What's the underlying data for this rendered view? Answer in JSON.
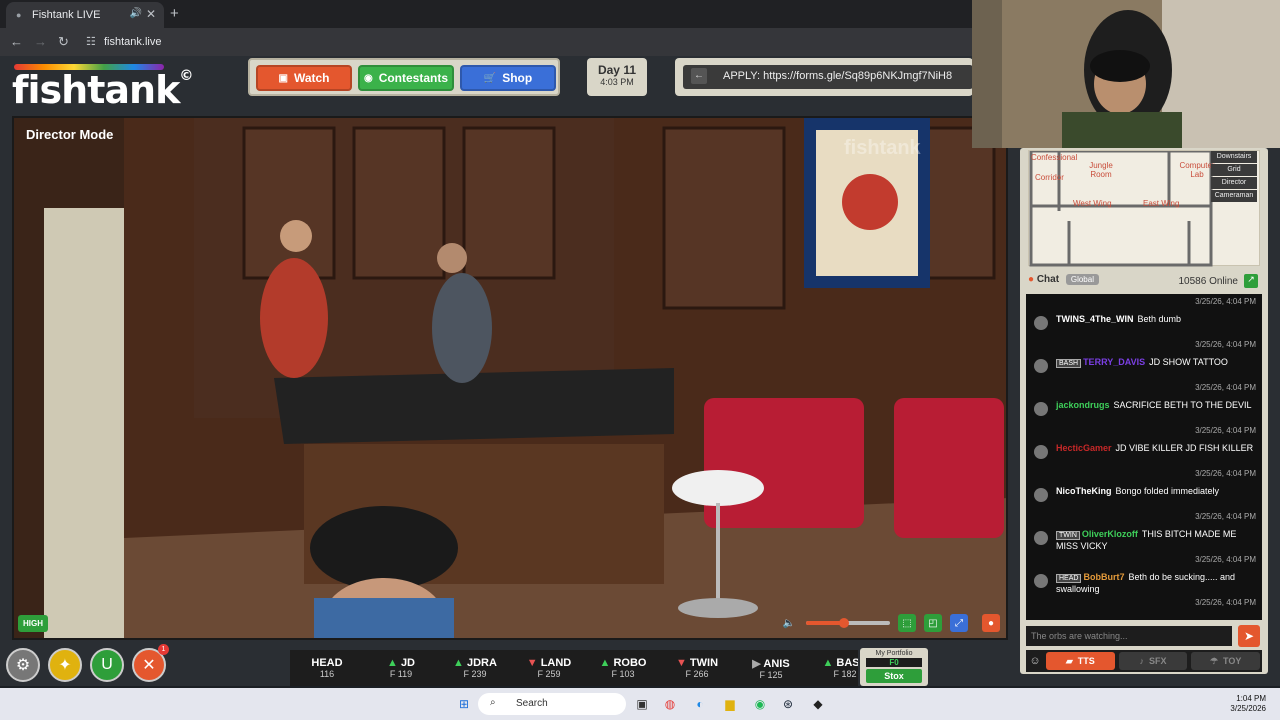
{
  "browser": {
    "tab_title": "Fishtank LIVE",
    "new_tab": "+",
    "url": "fishtank.live"
  },
  "header": {
    "logo": "fishtank",
    "nav": [
      {
        "label": "Watch",
        "color": "#e4572e"
      },
      {
        "label": "Contestants",
        "color": "#3bb24a"
      },
      {
        "label": "Shop",
        "color": "#3a6fd8"
      }
    ],
    "day": "Day 11",
    "time": "4:03 PM",
    "apply": "APPLY: https://forms.gle/Sq89p6NKJmgf7NiH8"
  },
  "video": {
    "mode_label": "Director Mode",
    "quality": "HIGH",
    "volume": 0.45,
    "watermark": "fishtank"
  },
  "ticker": [
    {
      "name": "HEAD",
      "price": "116",
      "dir": "up"
    },
    {
      "name": "JD",
      "price": "F 119",
      "dir": "up"
    },
    {
      "name": "JDRA",
      "price": "F 239",
      "dir": "up"
    },
    {
      "name": "LAND",
      "price": "F 259",
      "dir": "down"
    },
    {
      "name": "ROBO",
      "price": "F 103",
      "dir": "up"
    },
    {
      "name": "TWIN",
      "price": "F 266",
      "dir": "down"
    },
    {
      "name": "ANIS",
      "price": "F 125",
      "dir": "flat"
    },
    {
      "name": "BASH",
      "price": "F 182",
      "dir": "up"
    }
  ],
  "portfolio": {
    "label": "My Portfolio",
    "value": "F0",
    "button": "Stox"
  },
  "notifications": {
    "count": "1"
  },
  "map": {
    "rooms": [
      "Confessional",
      "Jungle Room",
      "Computer Lab",
      "Corridor",
      "West Wing",
      "East Wing"
    ],
    "buttons": [
      "Downstairs",
      "Grid",
      "Director",
      "Cameraman"
    ]
  },
  "chat": {
    "label": "Chat",
    "channel": "Global",
    "online": "10586 Online",
    "messages": [
      {
        "ts": "3/25/26, 4:04 PM",
        "tag": "",
        "user": "TWINS_4The_WIN",
        "user_color": "#ffffff",
        "text": "Beth dumb"
      },
      {
        "ts": "3/25/26, 4:04 PM",
        "tag": "BASH",
        "user": "TERRY_DAVIS",
        "user_color": "#7b3fe4",
        "text": "JD SHOW TATTOO"
      },
      {
        "ts": "3/25/26, 4:04 PM",
        "tag": "",
        "user": "jackondrugs",
        "user_color": "#3ecf5a",
        "text": "SACRIFICE BETH TO THE DEVIL"
      },
      {
        "ts": "3/25/26, 4:04 PM",
        "tag": "",
        "user": "HecticGamer",
        "user_color": "#c62828",
        "text": "JD VIBE KILLER JD FISH KILLER"
      },
      {
        "ts": "3/25/26, 4:04 PM",
        "tag": "",
        "user": "NicoTheKing",
        "user_color": "#ffffff",
        "text": "Bongo folded immediately"
      },
      {
        "ts": "3/25/26, 4:04 PM",
        "tag": "TWIN",
        "user": "OliverKlozoff",
        "user_color": "#3ecf5a",
        "text": "THIS BITCH MADE ME MISS VICKY"
      },
      {
        "ts": "3/25/26, 4:04 PM",
        "tag": "HEAD",
        "user": "BobBurt7",
        "user_color": "#e49a3a",
        "text": "Beth do be sucking..... and swallowing"
      },
      {
        "ts": "3/25/26, 4:04 PM",
        "tag": "",
        "user": "",
        "user_color": "#ffffff",
        "text": ""
      }
    ],
    "input_placeholder": "The orbs are watching...",
    "modes": [
      "TTS",
      "SFX",
      "TOY"
    ]
  },
  "taskbar": {
    "search": "Search",
    "time": "1:04 PM",
    "date": "3/25/2026"
  }
}
